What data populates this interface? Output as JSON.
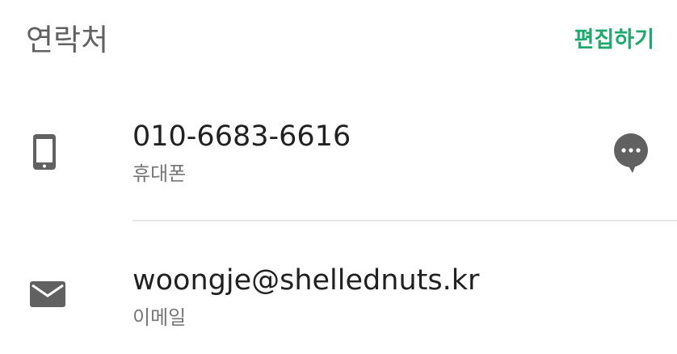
{
  "header": {
    "title": "연락처",
    "edit_label": "편집하기"
  },
  "contacts": [
    {
      "value": "010-6683-6616",
      "type": "휴대폰",
      "icon": "smartphone-icon",
      "action_icon": "chat-bubble-icon"
    },
    {
      "value": "woongje@shellednuts.kr",
      "type": "이메일",
      "icon": "mail-icon"
    }
  ],
  "colors": {
    "accent": "#1fa96f",
    "title": "#616161",
    "primary_text": "#212121",
    "secondary_text": "#757575",
    "icon": "#616161",
    "divider": "#e6e6e6"
  }
}
